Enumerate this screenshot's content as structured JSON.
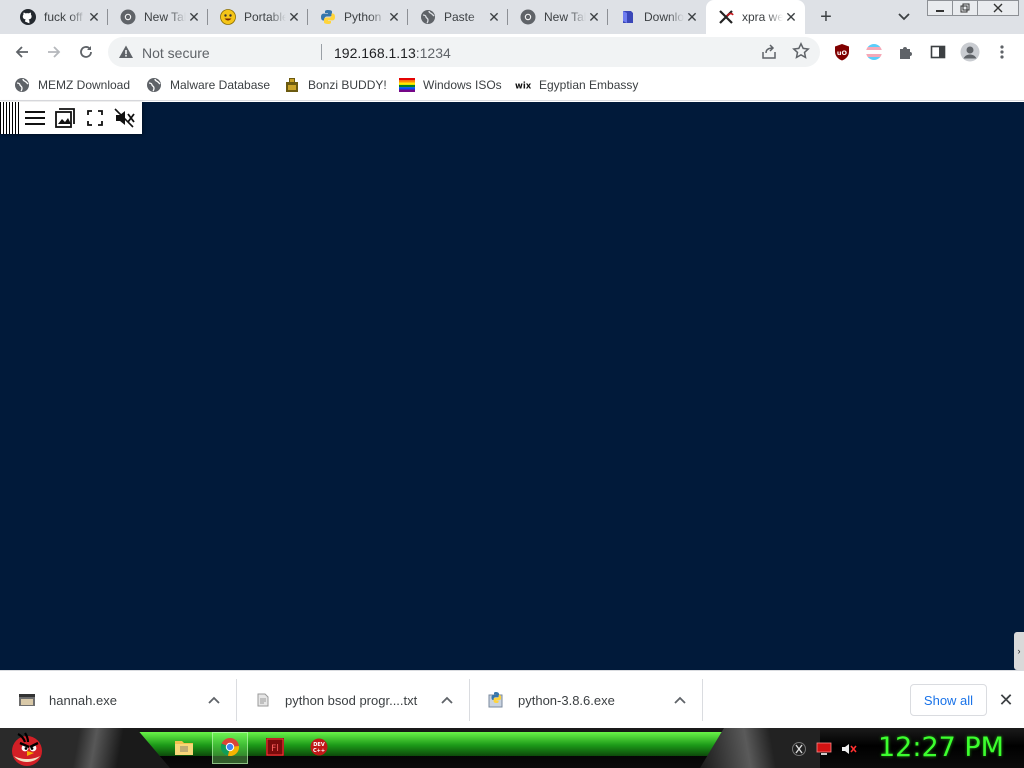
{
  "tabs": [
    {
      "title": "fuck off",
      "icon": "github-icon"
    },
    {
      "title": "New Tab",
      "icon": "chrome-icon"
    },
    {
      "title": "Portable",
      "icon": "emoji-icon"
    },
    {
      "title": "Python",
      "icon": "python-icon"
    },
    {
      "title": "Paste",
      "icon": "globe-icon"
    },
    {
      "title": "New Tab",
      "icon": "chrome-icon"
    },
    {
      "title": "Download",
      "icon": "book-icon"
    },
    {
      "title": "xpra web",
      "icon": "xpra-icon",
      "active": true
    }
  ],
  "toolbar": {
    "security_label": "Not secure",
    "url_host": "192.168.1.13",
    "url_port": ":1234"
  },
  "bookmarks": [
    {
      "label": "MEMZ Download",
      "icon": "globe-icon"
    },
    {
      "label": "Malware Database",
      "icon": "globe-icon"
    },
    {
      "label": "Bonzi BUDDY!",
      "icon": "bonzi-icon"
    },
    {
      "label": "Windows ISOs",
      "icon": "rainbow-flag-icon"
    },
    {
      "label": "Egyptian Embassy",
      "icon": "wix-icon"
    }
  ],
  "downloads": [
    {
      "name": "hannah.exe",
      "icon": "exe-icon"
    },
    {
      "name": "python bsod progr....txt",
      "icon": "text-file-icon"
    },
    {
      "name": "python-3.8.6.exe",
      "icon": "python-installer-icon"
    }
  ],
  "shelf": {
    "show_all": "Show all"
  },
  "taskbar": {
    "clock": "12:27 PM"
  },
  "colors": {
    "content_bg": "#011a3a",
    "tabstrip_bg": "#dee1e6",
    "clock": "#3cff2e",
    "link_blue": "#1a73e8"
  }
}
